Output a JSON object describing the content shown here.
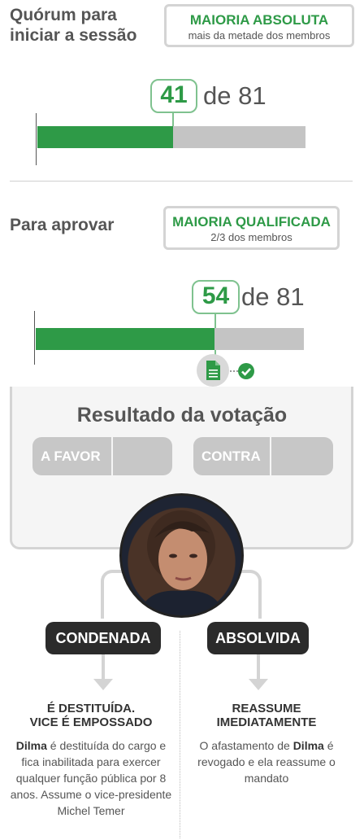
{
  "quorum": {
    "title": "Quórum para iniciar a sessão",
    "badge_title": "MAIORIA ABSOLUTA",
    "badge_sub": "mais da metade dos membros",
    "count": "41",
    "of": "de 81",
    "fraction": 0.506
  },
  "approve": {
    "title": "Para aprovar",
    "badge_title": "MAIORIA QUALIFICADA",
    "badge_sub": "2/3 dos membros",
    "count": "54",
    "of": "de 81",
    "fraction": 0.667
  },
  "result": {
    "title": "Resultado da votação",
    "favor_label": "A FAVOR",
    "contra_label": "CONTRA"
  },
  "outcomes": {
    "condemned": {
      "label": "CONDENADA",
      "title_1": "É DESTITUÍDA.",
      "title_2": "VICE É EMPOSSADO",
      "name": "Dilma",
      "text": " é destituída do cargo e fica inabilitada para exercer qualquer função pública por 8 anos. Assume o vice-presidente Michel Temer"
    },
    "absolved": {
      "label": "ABSOLVIDA",
      "title_1": "REASSUME",
      "title_2": "IMEDIATAMENTE",
      "text_pre": "O afastamento de ",
      "name": "Dilma",
      "text_post": " é revogado e ela reassume o mandato"
    }
  },
  "colors": {
    "green": "#2e9a47",
    "gray_bar": "#c4c4c4",
    "dark": "#2b2b2b"
  },
  "icons": [
    "document-icon",
    "check-icon",
    "portrait-photo"
  ]
}
